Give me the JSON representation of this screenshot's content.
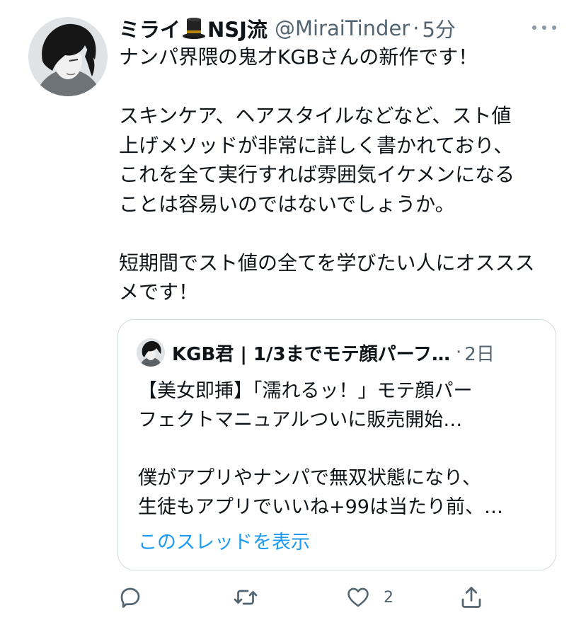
{
  "tweet": {
    "display_name_part1": "ミライ",
    "display_name_part2": "NSJ流",
    "name_emoji_icon": "top-hat-icon",
    "handle": "@MiraiTinder",
    "separator": "·",
    "time": "5分",
    "text_lines": [
      "ナンパ界隈の鬼才KGBさんの新作です！",
      "",
      "スキンケア、ヘアスタイルなどなど、スト値",
      "上げメソッドが非常に詳しく書かれており、",
      "これを全て実行すれば雰囲気イケメンになる",
      "ことは容易いのではないでしょうか。",
      "",
      "短期間でスト値の全てを学びたい人にオススス",
      "メです！"
    ]
  },
  "quote": {
    "name": "KGB君 | 1/3までモテ顔パーフ…",
    "separator": "·",
    "time": "2日",
    "text_lines": [
      "【美女即挿】「濡れるッ！」モテ顔パー",
      "フェクトマニュアルついに販売開始…",
      "",
      "僕がアプリやナンパで無双状態になり、",
      "生徒もアプリでいいね+99は当たり前、…"
    ],
    "thread_link": "このスレッドを表示"
  },
  "actions": {
    "reply_icon": "reply-icon",
    "retweet_icon": "retweet-icon",
    "like_icon": "heart-icon",
    "like_count": "2",
    "share_icon": "share-icon"
  },
  "colors": {
    "text": "#0f1419",
    "secondary": "#536471",
    "link": "#1d9bf0",
    "border": "#cfd9de"
  }
}
